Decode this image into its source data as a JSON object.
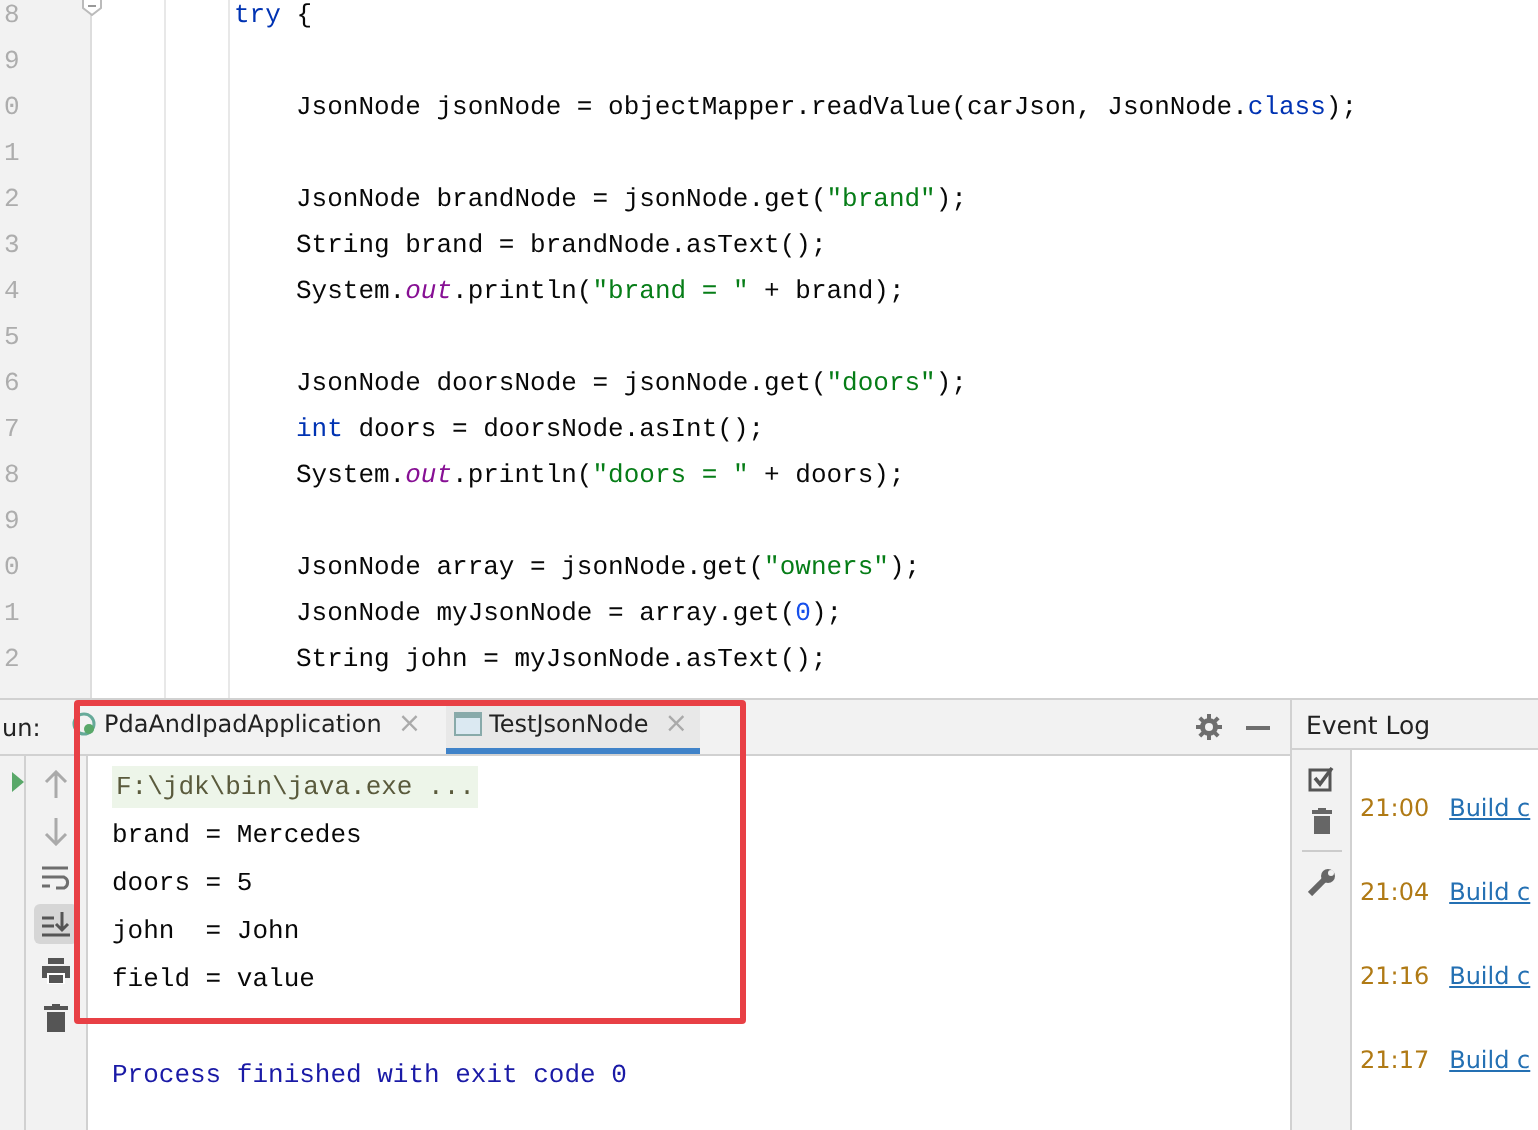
{
  "editor": {
    "lines": [
      {
        "number": "8",
        "segments": [
          {
            "kind": "keyword",
            "text": "try"
          },
          {
            "kind": "plain",
            "text": " {"
          }
        ],
        "children": [
          {
            "number": "9"
          },
          {
            "number": "0",
            "segments": [
              {
                "kind": "plain",
                "text": "JsonNode jsonNode = objectMapper.readValue(carJson, JsonNode."
              },
              {
                "kind": "keyword",
                "text": "class"
              },
              {
                "kind": "plain",
                "text": ");"
              }
            ]
          },
          {
            "number": "1"
          },
          {
            "number": "2",
            "segments": [
              {
                "kind": "plain",
                "text": "JsonNode brandNode = jsonNode.get("
              },
              {
                "kind": "string",
                "text": "\"brand\""
              },
              {
                "kind": "plain",
                "text": ");"
              }
            ]
          },
          {
            "number": "3",
            "segments": [
              {
                "kind": "plain",
                "text": "String brand = brandNode.asText();"
              }
            ]
          },
          {
            "number": "4",
            "segments": [
              {
                "kind": "plain",
                "text": "System."
              },
              {
                "kind": "field",
                "text": "out"
              },
              {
                "kind": "plain",
                "text": ".println("
              },
              {
                "kind": "string",
                "text": "\"brand = \""
              },
              {
                "kind": "plain",
                "text": " + brand);"
              }
            ]
          },
          {
            "number": "5"
          },
          {
            "number": "6",
            "segments": [
              {
                "kind": "plain",
                "text": "JsonNode doorsNode = jsonNode.get("
              },
              {
                "kind": "string",
                "text": "\"doors\""
              },
              {
                "kind": "plain",
                "text": ");"
              }
            ]
          },
          {
            "number": "7",
            "segments": [
              {
                "kind": "keyword",
                "text": "int"
              },
              {
                "kind": "plain",
                "text": " doors = doorsNode.asInt();"
              }
            ]
          },
          {
            "number": "8",
            "segments": [
              {
                "kind": "plain",
                "text": "System."
              },
              {
                "kind": "field",
                "text": "out"
              },
              {
                "kind": "plain",
                "text": ".println("
              },
              {
                "kind": "string",
                "text": "\"doors = \""
              },
              {
                "kind": "plain",
                "text": " + doors);"
              }
            ]
          },
          {
            "number": "9"
          },
          {
            "number": "0",
            "segments": [
              {
                "kind": "plain",
                "text": "JsonNode array = jsonNode.get("
              },
              {
                "kind": "string",
                "text": "\"owners\""
              },
              {
                "kind": "plain",
                "text": ");"
              }
            ]
          },
          {
            "number": "1",
            "segments": [
              {
                "kind": "plain",
                "text": "JsonNode myJsonNode = array.get("
              },
              {
                "kind": "number",
                "text": "0"
              },
              {
                "kind": "plain",
                "text": ");"
              }
            ]
          },
          {
            "number": "2",
            "segments": [
              {
                "kind": "plain",
                "text": "String john = myJsonNode.asText();"
              }
            ]
          }
        ]
      }
    ]
  },
  "run_panel": {
    "label": "un:",
    "tabs": [
      {
        "label": "PdaAndIpadApplication",
        "selected": false
      },
      {
        "label": "TestJsonNode",
        "selected": true
      }
    ],
    "close_glyph": "×",
    "console": [
      {
        "kind": "command",
        "text": "F:\\jdk\\bin\\java.exe ..."
      },
      {
        "kind": "output",
        "text": "brand = Mercedes"
      },
      {
        "kind": "output",
        "text": "doors = 5"
      },
      {
        "kind": "output",
        "text": "john  = John"
      },
      {
        "kind": "output",
        "text": "field = value"
      },
      {
        "kind": "exit",
        "text": "Process finished with exit code 0"
      }
    ]
  },
  "event_log": {
    "title": "Event Log",
    "entries": [
      {
        "time": "21:00",
        "link": "Build c"
      },
      {
        "time": "21:04",
        "link": "Build c"
      },
      {
        "time": "21:16",
        "link": "Build c"
      },
      {
        "time": "21:17",
        "link": "Build c"
      }
    ]
  }
}
